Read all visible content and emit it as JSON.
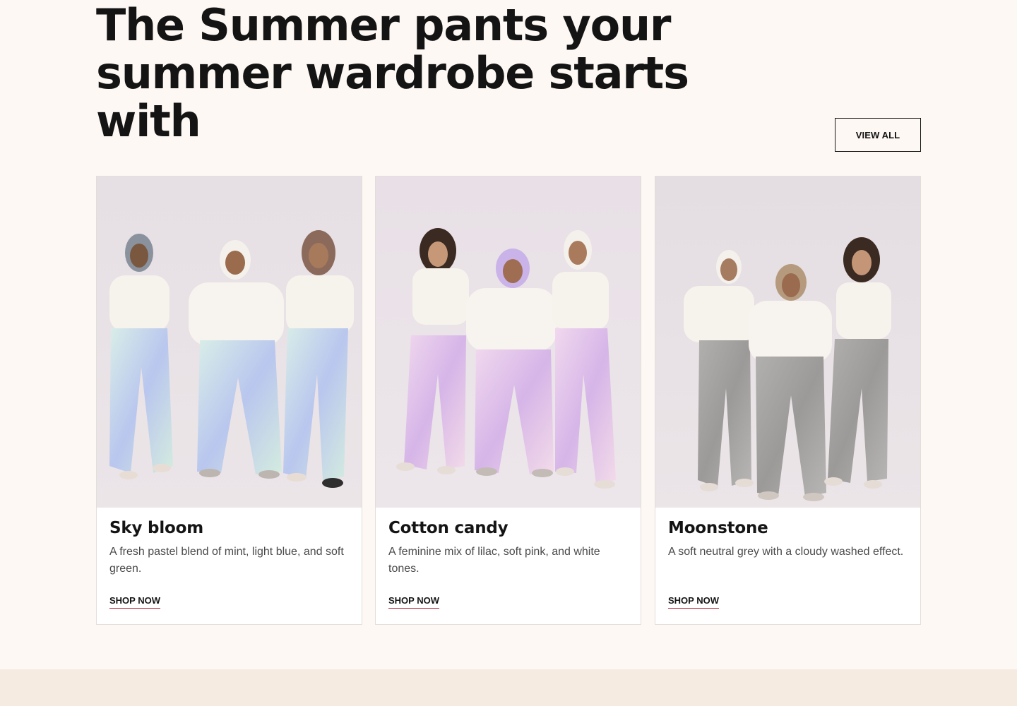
{
  "section": {
    "heading": "The Summer pants your summer wardrobe starts with",
    "view_all_label": "VIEW ALL"
  },
  "products": [
    {
      "title": "Sky bloom",
      "description": "A fresh pastel blend of mint, light blue, and soft green.",
      "cta": "SHOP NOW",
      "pants_color": "#cfe6e2",
      "accent_color": "#a9b8ea"
    },
    {
      "title": "Cotton candy",
      "description": "A feminine mix of lilac, soft pink, and white tones.",
      "cta": "SHOP NOW",
      "pants_color": "#ecd3ea",
      "accent_color": "#c7a7e6"
    },
    {
      "title": "Moonstone",
      "description": "A soft neutral grey with a cloudy washed effect.",
      "cta": "SHOP NOW",
      "pants_color": "#a9a7a6",
      "accent_color": "#8f8d8c"
    }
  ],
  "colors": {
    "background": "#fdf8f4",
    "footer_band": "#f5ebe1",
    "text": "#141414",
    "link_underline": "#b0192d"
  }
}
